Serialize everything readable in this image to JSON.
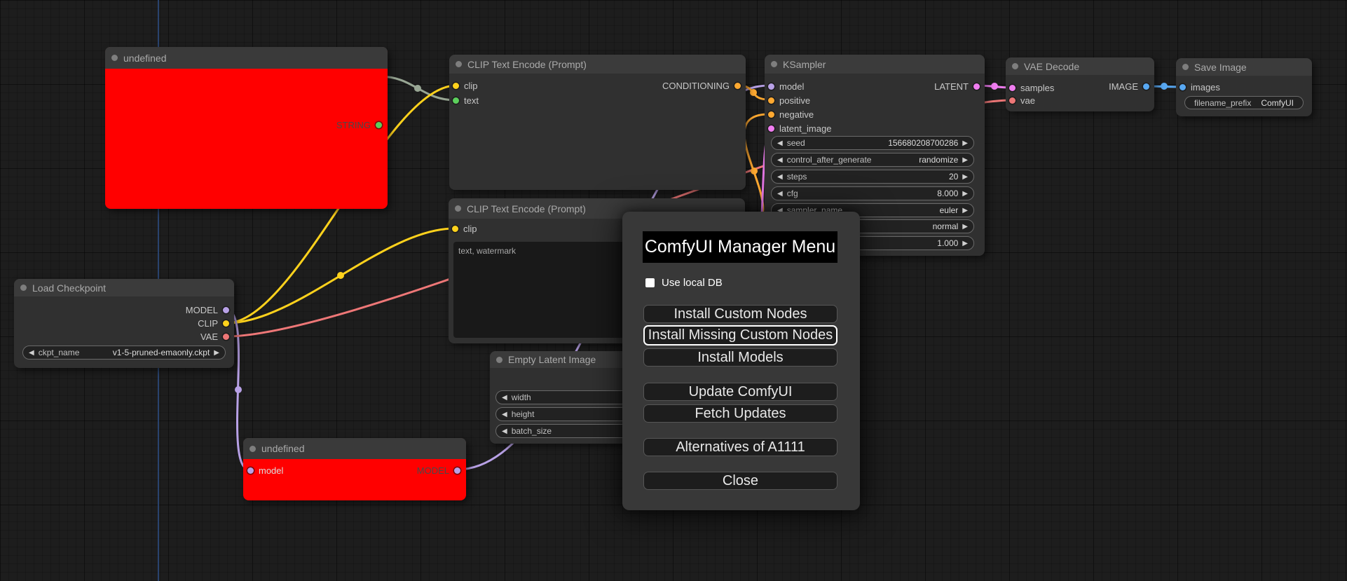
{
  "colors": {
    "model": "#b8a1e6",
    "clip": "#ffd21c",
    "vae": "#ee7777",
    "conditioning": "#ffa931",
    "latent": "#f07df0",
    "image": "#58a8f2",
    "string": "#5ccf5c",
    "string_wire": "#98a694",
    "node_error": "#ff0000"
  },
  "nodes": {
    "reroute_top": {
      "title": "undefined",
      "output": "STRING"
    },
    "clip_encode_1": {
      "title": "CLIP Text Encode (Prompt)",
      "inputs": [
        "clip",
        "text"
      ],
      "output": "CONDITIONING"
    },
    "ksampler": {
      "title": "KSampler",
      "inputs": [
        "model",
        "positive",
        "negative",
        "latent_image"
      ],
      "output": "LATENT",
      "widgets": [
        [
          "seed",
          "156680208700286"
        ],
        [
          "control_after_generate",
          "randomize"
        ],
        [
          "steps",
          "20"
        ],
        [
          "cfg",
          "8.000"
        ],
        [
          "sampler_name",
          "euler"
        ],
        [
          "",
          "normal"
        ],
        [
          "",
          "1.000"
        ]
      ]
    },
    "vae_decode": {
      "title": "VAE Decode",
      "inputs": [
        "samples",
        "vae"
      ],
      "output": "IMAGE"
    },
    "save_image": {
      "title": "Save Image",
      "inputs": [
        "images"
      ],
      "widgets": [
        [
          "filename_prefix",
          "ComfyUI"
        ]
      ]
    },
    "load_checkpoint": {
      "title": "Load Checkpoint",
      "outputs": [
        "MODEL",
        "CLIP",
        "VAE"
      ],
      "widgets": [
        [
          "ckpt_name",
          "v1-5-pruned-emaonly.ckpt"
        ]
      ]
    },
    "clip_encode_2": {
      "title": "CLIP Text Encode (Prompt)",
      "inputs": [
        "clip"
      ],
      "text_value": "text, watermark"
    },
    "empty_latent": {
      "title": "Empty Latent Image",
      "widgets": [
        [
          "width",
          ""
        ],
        [
          "height",
          ""
        ],
        [
          "batch_size",
          ""
        ]
      ]
    },
    "reroute_bottom": {
      "title": "undefined",
      "input": "model",
      "output": "MODEL"
    }
  },
  "menu": {
    "title": "ComfyUI Manager Menu",
    "checkbox_label": "Use local DB",
    "checkbox_checked": false,
    "buttons": [
      "Install Custom Nodes",
      "Install Missing Custom Nodes",
      "Install Models",
      "Update ComfyUI",
      "Fetch Updates",
      "Alternatives of A1111",
      "Close"
    ]
  }
}
